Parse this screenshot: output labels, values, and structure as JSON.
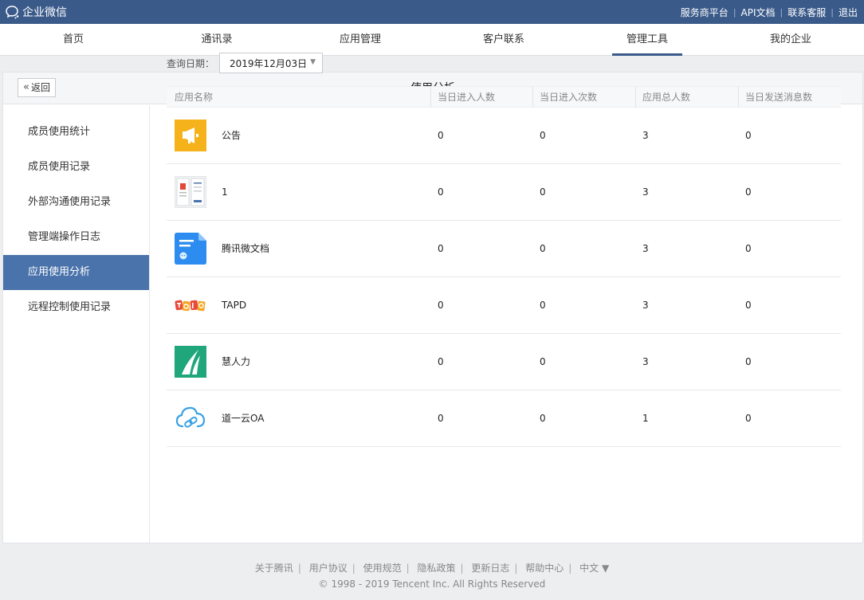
{
  "app": {
    "title": "企业微信"
  },
  "top_links": [
    "服务商平台",
    "API文档",
    "联系客服",
    "退出"
  ],
  "nav": {
    "items": [
      "首页",
      "通讯录",
      "应用管理",
      "客户联系",
      "管理工具",
      "我的企业"
    ],
    "active_index": 4
  },
  "panel": {
    "title": "使用分析",
    "back_label": "返回"
  },
  "sidebar": {
    "items": [
      "成员使用统计",
      "成员使用记录",
      "外部沟通使用记录",
      "管理端操作日志",
      "应用使用分析",
      "远程控制使用记录"
    ],
    "active_index": 4
  },
  "query": {
    "label": "查询日期：",
    "date": "2019年12月03日"
  },
  "table": {
    "headers": [
      "应用名称",
      "当日进入人数",
      "当日进入次数",
      "应用总人数",
      "当日发送消息数"
    ],
    "rows": [
      {
        "icon": "megaphone-icon",
        "name": "公告",
        "enter_users": "0",
        "enter_times": "0",
        "total_users": "3",
        "messages": "0"
      },
      {
        "icon": "app-screenshot-icon",
        "name": "1",
        "enter_users": "0",
        "enter_times": "0",
        "total_users": "3",
        "messages": "0"
      },
      {
        "icon": "document-icon",
        "name": "腾讯微文档",
        "enter_users": "0",
        "enter_times": "0",
        "total_users": "3",
        "messages": "0"
      },
      {
        "icon": "tapd-logo-icon",
        "name": "TAPD",
        "enter_users": "0",
        "enter_times": "0",
        "total_users": "3",
        "messages": "0"
      },
      {
        "icon": "huirenli-logo-icon",
        "name": "慧人力",
        "enter_users": "0",
        "enter_times": "0",
        "total_users": "3",
        "messages": "0"
      },
      {
        "icon": "cloud-link-icon",
        "name": "道一云OA",
        "enter_users": "0",
        "enter_times": "0",
        "total_users": "1",
        "messages": "0"
      }
    ]
  },
  "footer": {
    "links": [
      "关于腾讯",
      "用户协议",
      "使用规范",
      "隐私政策",
      "更新日志",
      "帮助中心",
      "中文 ▼"
    ],
    "copyright": "© 1998 - 2019 Tencent Inc. All Rights Reserved"
  },
  "colors": {
    "topbar": "#3a5a8a",
    "active_side": "#4a73ab",
    "page_bg": "#eceef0"
  }
}
